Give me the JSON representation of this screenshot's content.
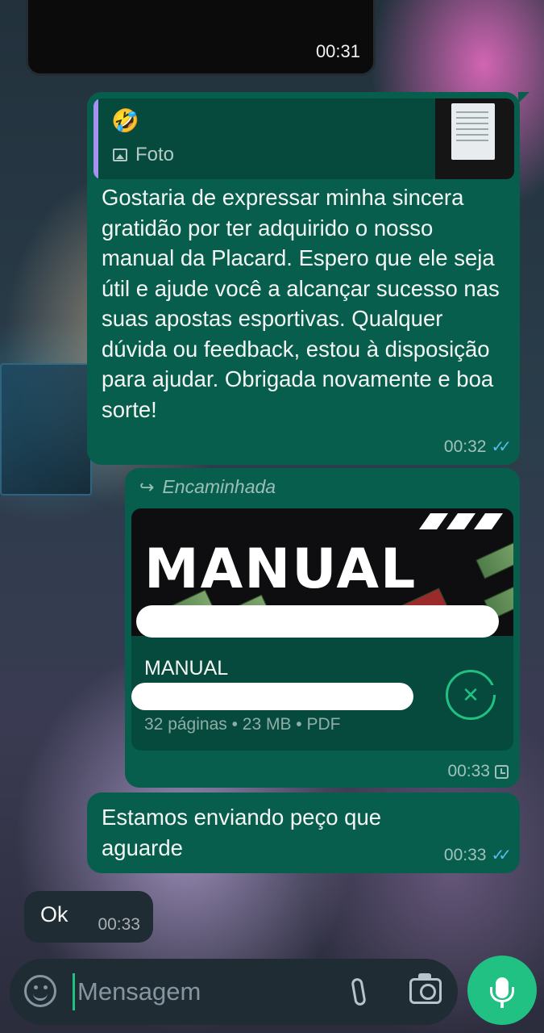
{
  "video_message": {
    "time": "00:31"
  },
  "reply_message": {
    "quote": {
      "emoji": "🤣",
      "label": "Foto"
    },
    "text": "Gostaria de expressar minha sincera gratidão por ter adquirido o nosso manual da Placard. Espero que ele seja útil e ajude você a alcançar sucesso nas suas apostas esportivas. Qualquer dúvida ou feedback, estou à disposição para ajudar. Obrigada novamente e boa sorte!",
    "time": "00:32",
    "status": "read"
  },
  "document_message": {
    "forwarded_label": "Encaminhada",
    "preview_title": "MANUAL",
    "file_name": "MANUAL",
    "ellipsis": "..",
    "meta": "32 páginas • 23 MB • PDF",
    "time": "00:33",
    "status": "pending"
  },
  "sending_message": {
    "text": "Estamos enviando peço que aguarde",
    "time": "00:33",
    "status": "read"
  },
  "incoming_message": {
    "text": "Ok",
    "time": "00:33"
  },
  "composer": {
    "placeholder": "Mensagem"
  },
  "colors": {
    "outgoing_bubble": "#075e4c",
    "incoming_bubble": "#1f2c34",
    "accent": "#21c083",
    "read_ticks": "#53bdeb"
  }
}
